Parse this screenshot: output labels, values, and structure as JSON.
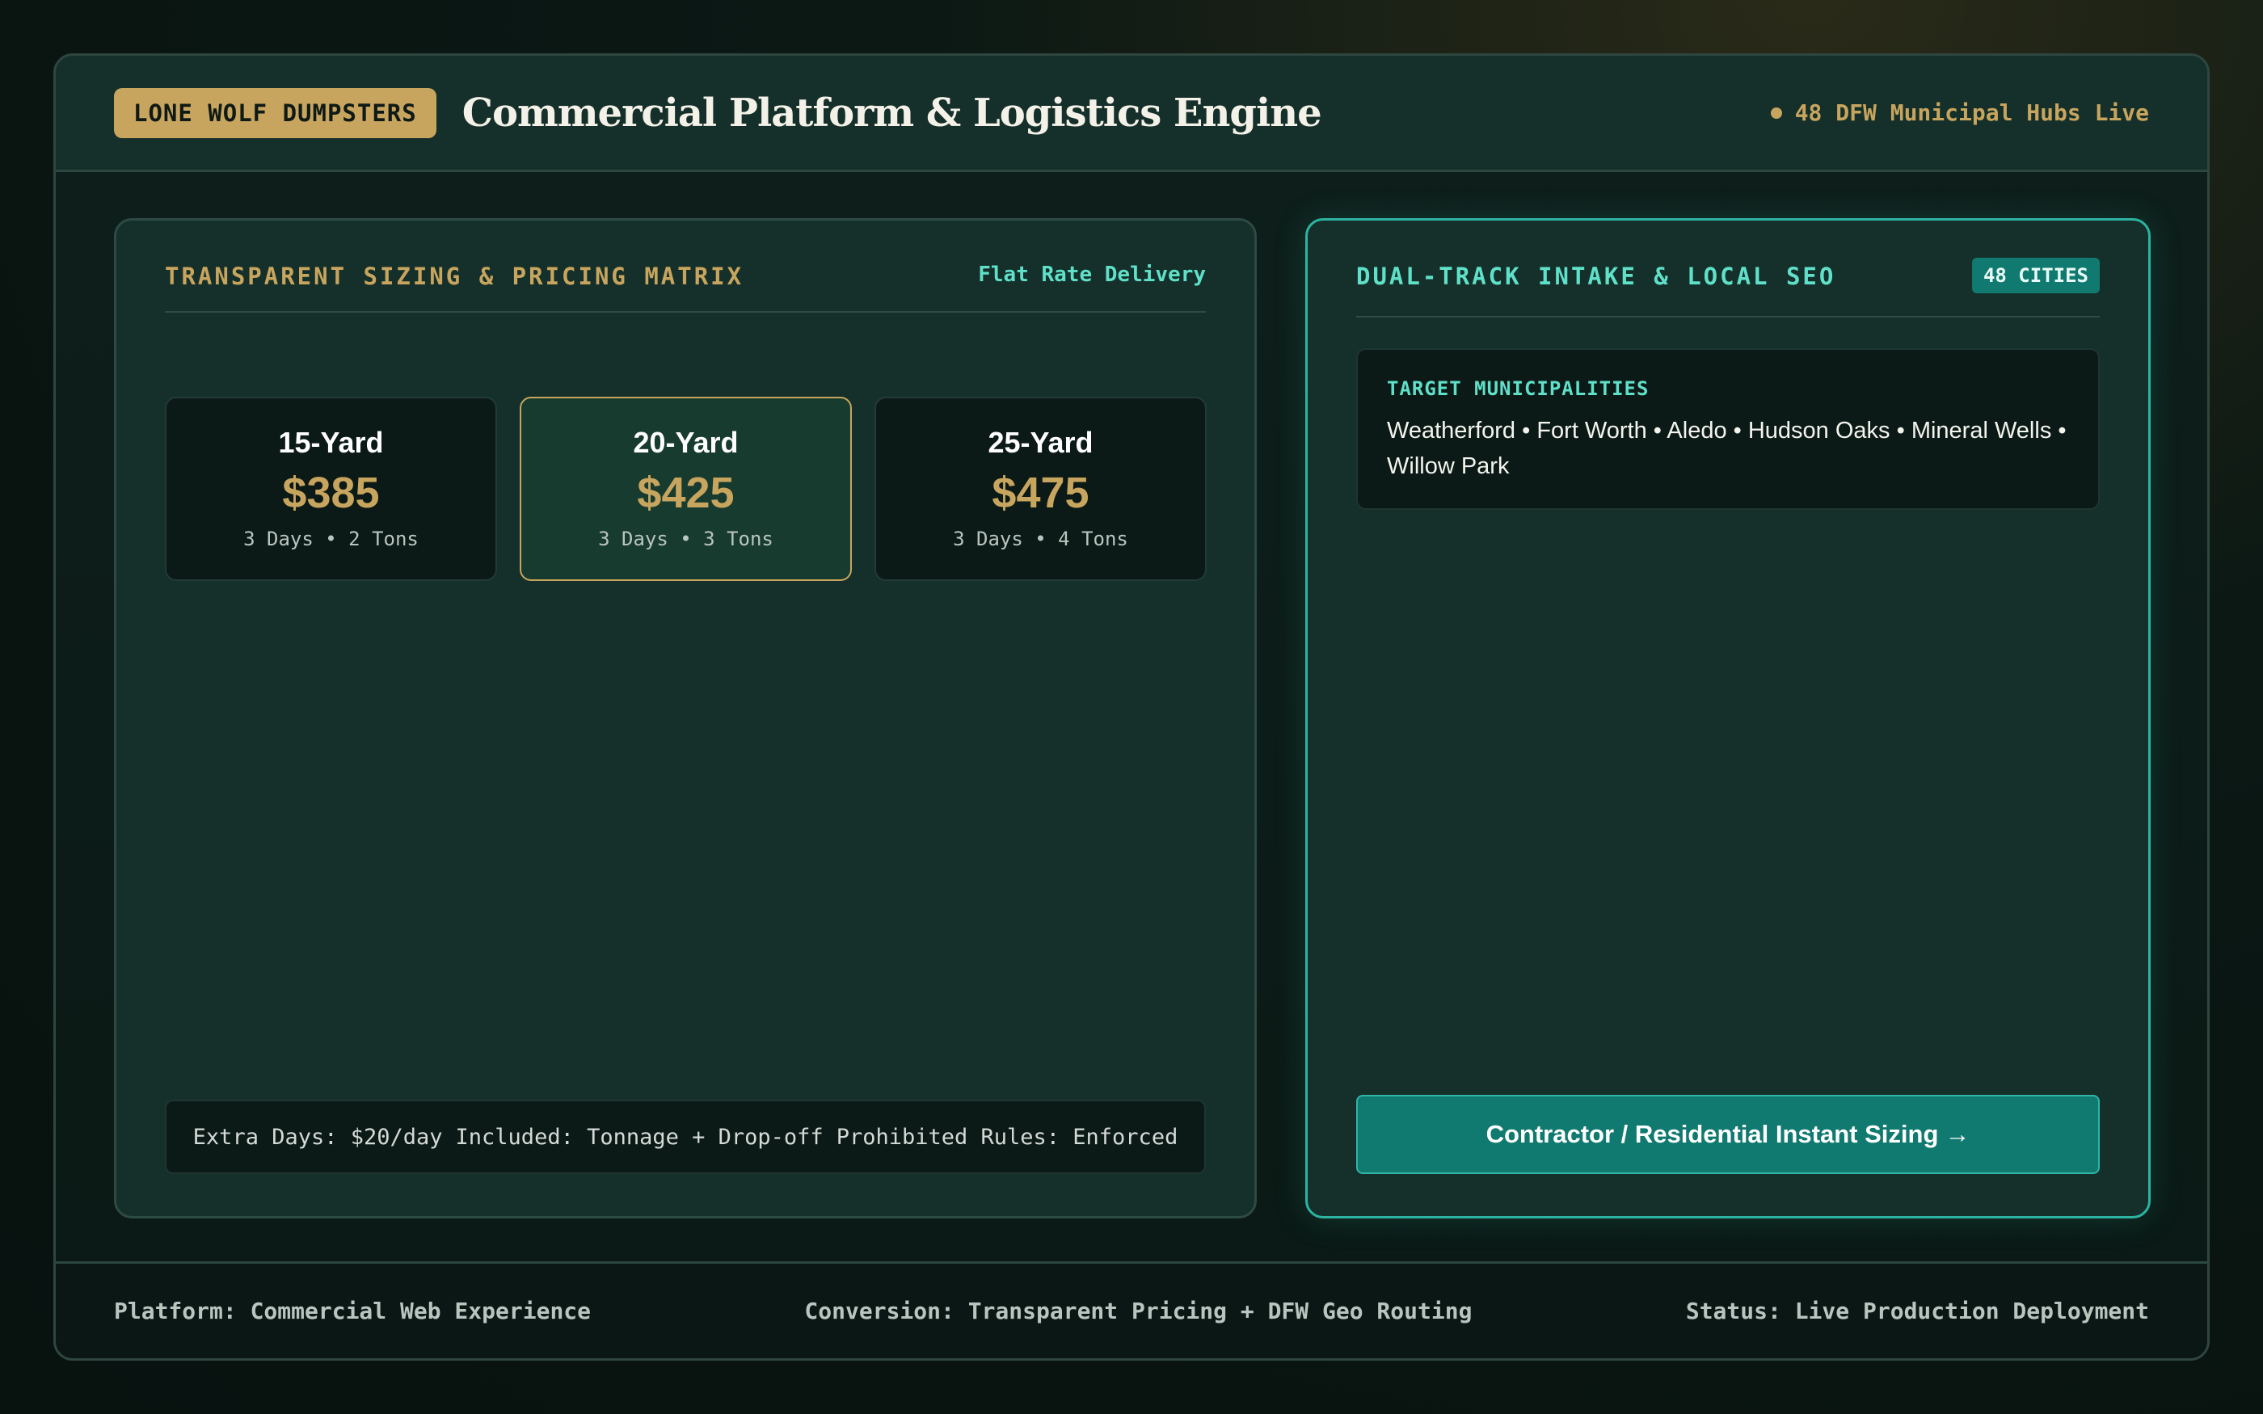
{
  "header": {
    "brand": "LONE WOLF DUMPSTERS",
    "title": "Commercial Platform & Logistics Engine",
    "status": "48 DFW Municipal Hubs Live"
  },
  "pricing": {
    "title": "TRANSPARENT SIZING & PRICING MATRIX",
    "meta": "Flat Rate Delivery",
    "cards": [
      {
        "size": "15-Yard",
        "price": "$385",
        "terms": "3 Days • 2 Tons"
      },
      {
        "size": "20-Yard",
        "price": "$425",
        "terms": "3 Days • 3 Tons"
      },
      {
        "size": "25-Yard",
        "price": "$475",
        "terms": "3 Days • 4 Tons"
      }
    ],
    "rules": [
      "Extra Days: $20/day",
      "Included: Tonnage + Drop-off",
      "Prohibited Rules: Enforced"
    ]
  },
  "intake": {
    "title": "DUAL-TRACK INTAKE & LOCAL SEO",
    "badge": "48 CITIES",
    "municipalities_label": "TARGET MUNICIPALITIES",
    "municipalities": "Weatherford • Fort Worth • Aledo • Hudson Oaks • Mineral Wells • Willow Park",
    "cta_label": "Contractor / Residential Instant Sizing",
    "cta_arrow": "→"
  },
  "footer": {
    "platform": "Platform: Commercial Web Experience",
    "conversion": "Conversion: Transparent Pricing + DFW Geo Routing",
    "status": "Status: Live Production Deployment"
  },
  "colors": {
    "gold": "#c8a55e",
    "teal": "#5fe0c9",
    "teal_button": "#117a70",
    "panel": "#15302a"
  }
}
